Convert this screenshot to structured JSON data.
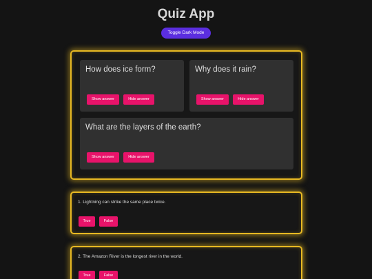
{
  "header": {
    "title": "Quiz App",
    "toggle_label": "Toggle Dark Mode"
  },
  "flashcards": [
    {
      "question": "How does ice form?",
      "show_label": "Show answer",
      "hide_label": "Hide answer"
    },
    {
      "question": "Why does it rain?",
      "show_label": "Show answer",
      "hide_label": "Hide answer"
    },
    {
      "question": "What are the layers of the earth?",
      "show_label": "Show answer",
      "hide_label": "Hide answer"
    }
  ],
  "true_false": [
    {
      "question": "1. Lightning can strike the same place twice.",
      "true_label": "True",
      "false_label": "False"
    },
    {
      "question": "2. The Amazon River is the longest river in the world.",
      "true_label": "True",
      "false_label": "False"
    }
  ],
  "colors": {
    "background": "#141414",
    "accent_purple": "#5b2ee0",
    "accent_pink": "#e8136a",
    "glow_yellow": "#e8b923",
    "card": "#303030"
  }
}
